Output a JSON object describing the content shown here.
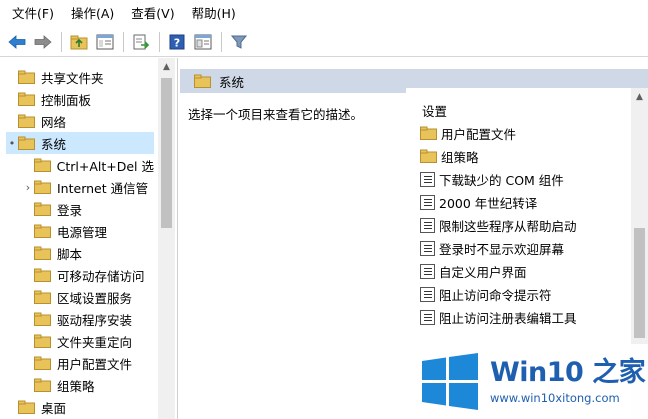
{
  "menubar": {
    "items": [
      "文件(F)",
      "操作(A)",
      "查看(V)",
      "帮助(H)"
    ]
  },
  "toolbar": {
    "buttons": [
      "back-icon",
      "forward-icon",
      "up-folder-icon",
      "show-hide-tree-icon",
      "export-list-icon",
      "help-icon",
      "properties-icon",
      "filter-icon"
    ]
  },
  "tree": {
    "items": [
      {
        "label": "共享文件夹",
        "indent": 0,
        "expander": "",
        "selected": false
      },
      {
        "label": "控制面板",
        "indent": 0,
        "expander": "",
        "selected": false
      },
      {
        "label": "网络",
        "indent": 0,
        "expander": "",
        "selected": false
      },
      {
        "label": "系统",
        "indent": 0,
        "expander": "•",
        "selected": true
      },
      {
        "label": "Ctrl+Alt+Del 选",
        "indent": 1,
        "expander": "",
        "selected": false
      },
      {
        "label": "Internet 通信管",
        "indent": 1,
        "expander": "›",
        "selected": false
      },
      {
        "label": "登录",
        "indent": 1,
        "expander": "",
        "selected": false
      },
      {
        "label": "电源管理",
        "indent": 1,
        "expander": "",
        "selected": false
      },
      {
        "label": "脚本",
        "indent": 1,
        "expander": "",
        "selected": false
      },
      {
        "label": "可移动存储访问",
        "indent": 1,
        "expander": "",
        "selected": false
      },
      {
        "label": "区域设置服务",
        "indent": 1,
        "expander": "",
        "selected": false
      },
      {
        "label": "驱动程序安装",
        "indent": 1,
        "expander": "",
        "selected": false
      },
      {
        "label": "文件夹重定向",
        "indent": 1,
        "expander": "",
        "selected": false
      },
      {
        "label": "用户配置文件",
        "indent": 1,
        "expander": "",
        "selected": false
      },
      {
        "label": "组策略",
        "indent": 1,
        "expander": "",
        "selected": false
      },
      {
        "label": "桌面",
        "indent": 0,
        "expander": "",
        "selected": false
      }
    ]
  },
  "right": {
    "header_title": "系统",
    "description": "选择一个项目来查看它的描述。",
    "list_header": "设置",
    "items": [
      {
        "label": "用户配置文件",
        "icon": "folder-icon"
      },
      {
        "label": "组策略",
        "icon": "folder-icon"
      },
      {
        "label": "下载缺少的 COM 组件",
        "icon": "policy-setting-icon"
      },
      {
        "label": "2000 年世纪转译",
        "icon": "policy-setting-icon"
      },
      {
        "label": "限制这些程序从帮助启动",
        "icon": "policy-setting-icon"
      },
      {
        "label": "登录时不显示欢迎屏幕",
        "icon": "policy-setting-icon"
      },
      {
        "label": "自定义用户界面",
        "icon": "policy-setting-icon"
      },
      {
        "label": "阻止访问命令提示符",
        "icon": "policy-setting-icon"
      },
      {
        "label": "阻止访问注册表编辑工具",
        "icon": "policy-setting-icon"
      }
    ]
  },
  "watermark": {
    "title": "Win10 之家",
    "url": "www.win10xitong.com"
  },
  "colors": {
    "selection": "#cce8ff",
    "header_band": "#cfd8e6",
    "folder": "#e8c35a",
    "brand_blue": "#1f5fb0"
  }
}
